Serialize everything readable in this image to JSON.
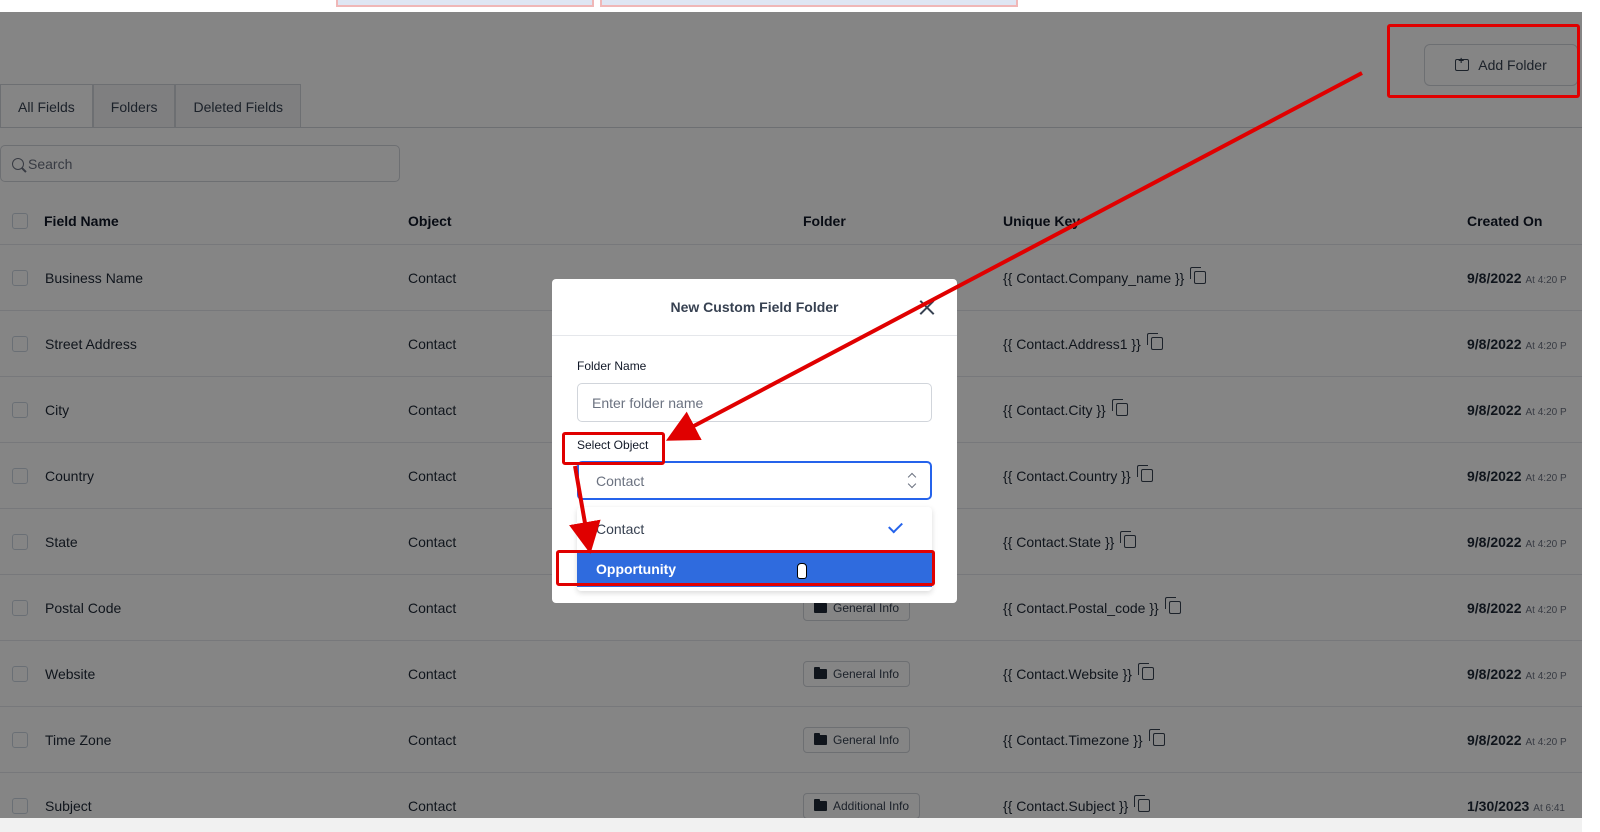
{
  "header": {
    "add_folder_label": "Add Folder"
  },
  "tabs": [
    {
      "label": "All Fields",
      "active": true
    },
    {
      "label": "Folders",
      "active": false
    },
    {
      "label": "Deleted Fields",
      "active": false
    }
  ],
  "search": {
    "placeholder": "Search"
  },
  "table": {
    "columns": [
      "Field Name",
      "Object",
      "Folder",
      "Unique Key",
      "Created On"
    ],
    "rows": [
      {
        "name": "Business Name",
        "object": "Contact",
        "folder": "",
        "key": "{{ Contact.Company_name }}",
        "date": "9/8/2022",
        "time": "At 4:20 P"
      },
      {
        "name": "Street Address",
        "object": "Contact",
        "folder": "",
        "key": "{{ Contact.Address1 }}",
        "date": "9/8/2022",
        "time": "At 4:20 P"
      },
      {
        "name": "City",
        "object": "Contact",
        "folder": "",
        "key": "{{ Contact.City }}",
        "date": "9/8/2022",
        "time": "At 4:20 P"
      },
      {
        "name": "Country",
        "object": "Contact",
        "folder": "",
        "key": "{{ Contact.Country }}",
        "date": "9/8/2022",
        "time": "At 4:20 P"
      },
      {
        "name": "State",
        "object": "Contact",
        "folder": "",
        "key": "{{ Contact.State }}",
        "date": "9/8/2022",
        "time": "At 4:20 P"
      },
      {
        "name": "Postal Code",
        "object": "Contact",
        "folder": "General Info",
        "key": "{{ Contact.Postal_code }}",
        "date": "9/8/2022",
        "time": "At 4:20 P"
      },
      {
        "name": "Website",
        "object": "Contact",
        "folder": "General Info",
        "key": "{{ Contact.Website }}",
        "date": "9/8/2022",
        "time": "At 4:20 P"
      },
      {
        "name": "Time Zone",
        "object": "Contact",
        "folder": "General Info",
        "key": "{{ Contact.Timezone }}",
        "date": "9/8/2022",
        "time": "At 4:20 P"
      },
      {
        "name": "Subject",
        "object": "Contact",
        "folder": "Additional Info",
        "key": "{{ Contact.Subject }}",
        "date": "1/30/2023",
        "time": "At 6:41"
      }
    ]
  },
  "modal": {
    "title": "New Custom Field Folder",
    "folder_name_label": "Folder Name",
    "folder_name_placeholder": "Enter folder name",
    "select_object_label": "Select Object",
    "select_value": "Contact",
    "options": [
      {
        "label": "Contact",
        "selected": true
      },
      {
        "label": "Opportunity",
        "highlighted": true
      }
    ]
  },
  "colors": {
    "accent": "#2f6bde",
    "annotation": "#e00000",
    "overlay": "rgba(0,0,0,0.48)"
  }
}
